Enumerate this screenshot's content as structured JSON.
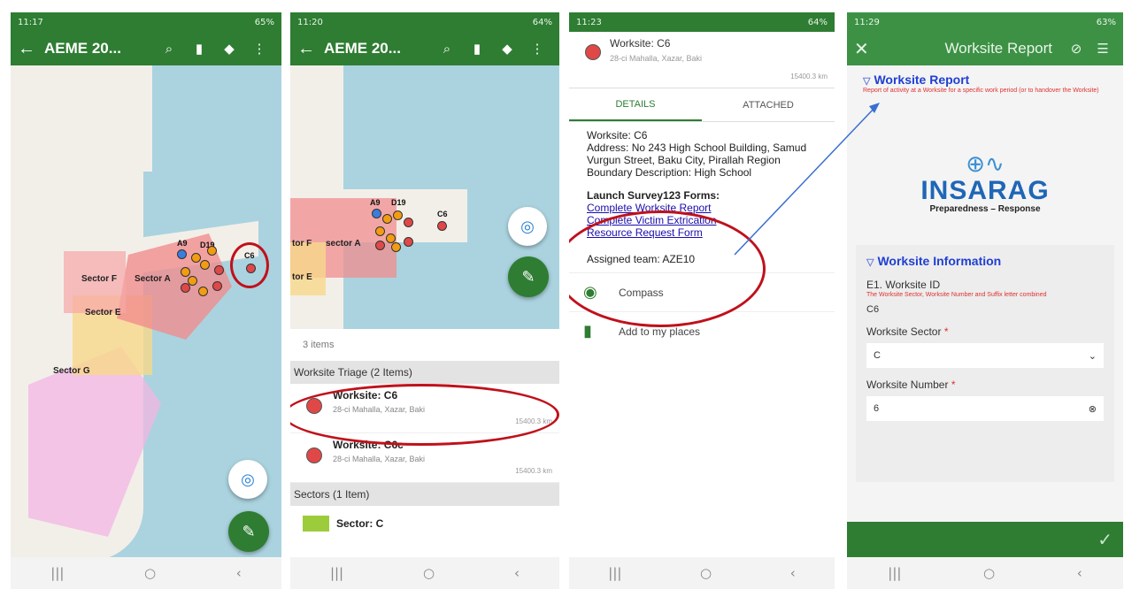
{
  "colors": {
    "app_green": "#2e7d32",
    "annotation_red": "#c0111b",
    "link_blue": "#1a0dab",
    "sea": "#aad3df",
    "sector_a": "#f08d8d",
    "sector_e": "#f7d88a",
    "sector_g": "#f3b6e3"
  },
  "panel1": {
    "status": {
      "time": "11:17",
      "battery": "65%"
    },
    "appbar": {
      "title": "AEME 20...",
      "icons": [
        "back-arrow-icon",
        "search-icon",
        "bookmark-icon",
        "layers-icon",
        "more-icon"
      ]
    },
    "map_labels": {
      "a9": "A9",
      "d19": "D19",
      "c6": "C6",
      "sector_f": "Sector F",
      "sector_a": "Sector A",
      "sector_e": "Sector E",
      "sector_g": "Sector G"
    }
  },
  "panel2": {
    "status": {
      "time": "11:20",
      "battery": "64%"
    },
    "appbar": {
      "title": "AEME 20..."
    },
    "map_labels": {
      "a9": "A9",
      "d19": "D19",
      "c6": "C6",
      "sector_f": "tor F",
      "sector_a": "sector A",
      "sector_e": "tor E"
    },
    "list": {
      "count": "3 items",
      "group1": "Worksite Triage (2 Items)",
      "items": [
        {
          "name": "Worksite: C6",
          "address": "28-ci Mahalla, Xazar, Baki",
          "distance": "15400.3 km"
        },
        {
          "name": "Worksite: C6c",
          "address": "28-ci Mahalla, Xazar, Baki",
          "distance": "15400.3 km"
        }
      ],
      "group2": "Sectors (1 Item)",
      "sector_item": "Sector: C"
    }
  },
  "panel3": {
    "status": {
      "time": "11:23",
      "battery": "64%"
    },
    "header": {
      "name": "Worksite: C6",
      "address": "28-ci Mahalla, Xazar, Baki",
      "distance": "15400.3 km"
    },
    "tabs": [
      "DETAILS",
      "ATTACHED"
    ],
    "details": {
      "worksite": "Worksite: C6",
      "address": "Address: No 243 High School Building, Samud Vurgun Street, Baku City, Pirallah Region",
      "boundary": "Boundary Description: High School",
      "launch_header": "Launch Survey123 Forms:",
      "links": [
        "Complete Worksite Report",
        "Complete Victim Extrication",
        "Resource Request Form"
      ],
      "team": "Assigned team: AZE10"
    },
    "actions": [
      "Compass",
      "Add to my places"
    ]
  },
  "panel4": {
    "status": {
      "time": "11:29",
      "battery": "63%"
    },
    "formbar": {
      "title": "Worksite Report"
    },
    "form": {
      "section_title": "Worksite Report",
      "section_hint": "Report of activity at a Worksite for a specific work period (or to handover the Worksite)",
      "logo_word": "INSARAG",
      "logo_tagline": "Preparedness – Response",
      "subsection_title": "Worksite Information",
      "field1_label": "E1. Worksite ID",
      "field1_hint": "The Worksite Sector, Worksite Number and Suffix letter combined",
      "field1_value": "C6",
      "field2_label": "Worksite Sector",
      "field2_value": "C",
      "field3_label": "Worksite Number",
      "field3_value": "6"
    }
  }
}
